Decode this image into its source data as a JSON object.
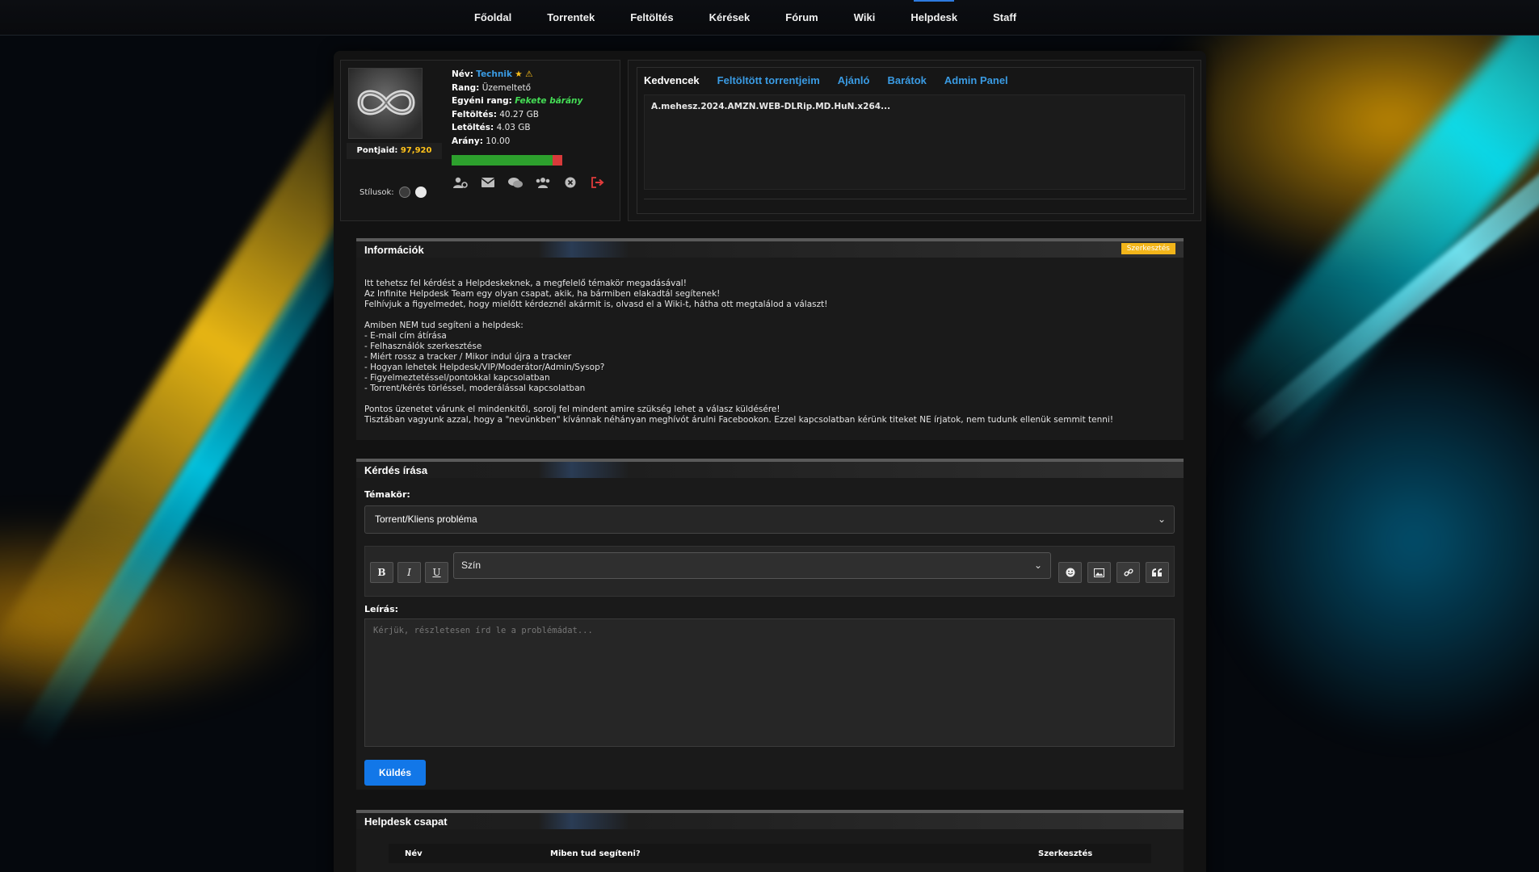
{
  "nav": {
    "items": [
      "Főoldal",
      "Torrentek",
      "Feltöltés",
      "Kérések",
      "Fórum",
      "Wiki",
      "Helpdesk",
      "Staff"
    ],
    "active": "Helpdesk"
  },
  "profile": {
    "points_label": "Pontjaid:",
    "points_value": "97,920",
    "styles_label": "Stílusok:",
    "name_label": "Név:",
    "name": "Technik",
    "rank_label": "Rang:",
    "rank": "Üzemeltető",
    "custom_rank_label": "Egyéni rang:",
    "custom_rank": "Fekete bárány",
    "upload_label": "Feltöltés:",
    "upload": "40.27 GB",
    "download_label": "Letöltés:",
    "download": "4.03 GB",
    "ratio_label": "Arány:",
    "ratio": "10.00",
    "ratio_bar_fraction": 0.91,
    "icons": [
      "user-settings-icon",
      "mail-icon",
      "chat-icon",
      "friends-icon",
      "close-circle-icon",
      "logout-icon"
    ]
  },
  "tabs": {
    "items": [
      "Kedvencek",
      "Feltöltött torrentjeim",
      "Ajánló",
      "Barátok",
      "Admin Panel"
    ],
    "active": "Kedvencek",
    "content_item": "A.mehesz.2024.AMZN.WEB-DLRip.MD.HuN.x264..."
  },
  "info": {
    "title": "Információk",
    "edit_label": "Szerkesztés",
    "text": "Itt tehetsz fel kérdést a Helpdeskeknek, a megfelelő témakör megadásával!\nAz Infinite Helpdesk Team egy olyan csapat, akik, ha bármiben elakadtál segítenek!\nFelhívjuk a figyelmedet, hogy mielőtt kérdeznél akármit is, olvasd el a Wiki-t, hátha ott megtalálod a választ!\n\nAmiben NEM tud segíteni a helpdesk:\n- E-mail cím átírása\n- Felhasználók szerkesztése\n- Miért rossz a tracker / Mikor indul újra a tracker\n- Hogyan lehetek Helpdesk/VIP/Moderátor/Admin/Sysop?\n- Figyelmeztetéssel/pontokkal kapcsolatban\n- Torrent/kérés törléssel, moderálással kapcsolatban\n\nPontos üzenetet várunk el mindenkitől, sorolj fel mindent amire szükség lehet a válasz küldésére!\nTisztában vagyunk azzal, hogy a \"nevünkben\" kívánnak néhányan meghívót árulni Facebookon. Ezzel kapcsolatban kérünk titeket NE írjatok, nem tudunk ellenük semmit tenni!"
  },
  "ask": {
    "title": "Kérdés írása",
    "topic_label": "Témakör:",
    "topic_value": "Torrent/Kliens probléma",
    "color_select": "Szín",
    "toolbar": {
      "bold": "B",
      "italic": "I",
      "underline": "U"
    },
    "toolbar_right_icons": [
      "smiley-icon",
      "image-icon",
      "link-icon",
      "quote-icon"
    ],
    "description_label": "Leírás:",
    "description_placeholder": "Kérjük, részletesen írd le a problémádat...",
    "send_label": "Küldés"
  },
  "team": {
    "title": "Helpdesk csapat",
    "columns": [
      "Név",
      "Miben tud segíteni?",
      "Szerkesztés"
    ]
  },
  "colors": {
    "accent_blue": "#3a9be3",
    "points_yellow": "#ffc21a",
    "rank_green": "#44dd55",
    "edit_yellow": "#f2b51a",
    "send_blue": "#1277e8"
  }
}
